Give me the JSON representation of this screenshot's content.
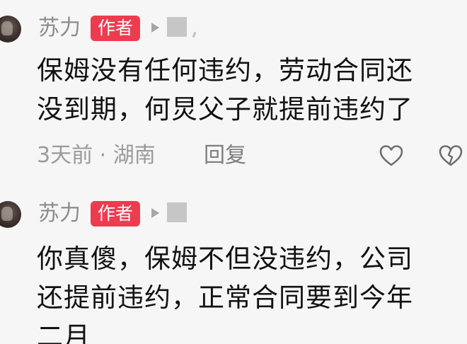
{
  "comments": [
    {
      "username": "苏力",
      "badge": "作者",
      "lines": [
        "保姆没有任何违约，劳动合同还",
        "没到期，何炅父子就提前违约了"
      ],
      "meta": "3天前 · 湖南",
      "reply_label": "回复",
      "icons": {
        "like": "heart-outline-icon",
        "dislike": "broken-heart-icon",
        "play": "play-icon"
      }
    },
    {
      "username": "苏力",
      "badge": "作者",
      "lines": [
        "你真傻，保姆不但没违约，公司",
        "还提前违约，正常合同要到今年",
        "二月"
      ],
      "icons": {
        "play": "play-icon"
      }
    }
  ],
  "colors": {
    "background": "#f6f6f6",
    "badge": "#ee3c4f",
    "username": "#8c8c8c",
    "text": "#121212",
    "meta": "#9a9a9a"
  }
}
